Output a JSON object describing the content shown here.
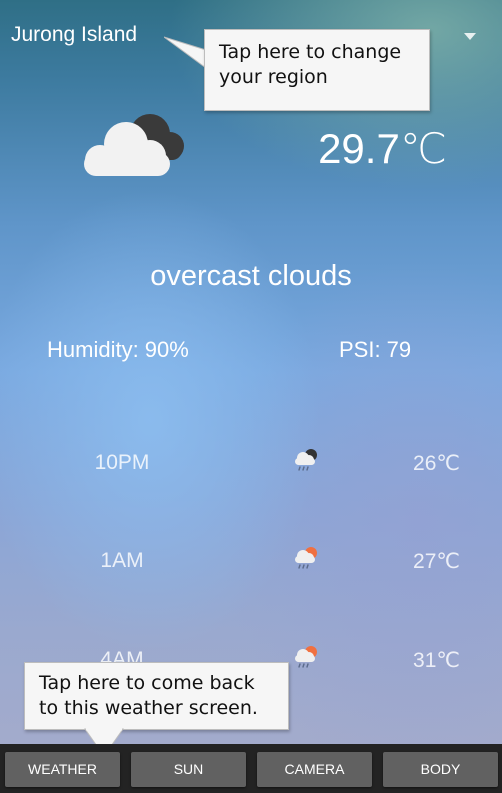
{
  "header": {
    "region": "Jurong Island",
    "dropdown_icon": "caret-down-icon"
  },
  "current": {
    "temperature": "29.7℃",
    "icon": "cloud-icon",
    "condition": "overcast clouds",
    "humidity": "Humidity: 90%",
    "psi": "PSI: 79"
  },
  "forecast": [
    {
      "time": "10PM",
      "icon": "night-rain-icon",
      "temp": "26℃"
    },
    {
      "time": "1AM",
      "icon": "rain-icon",
      "temp": "27℃"
    },
    {
      "time": "4AM",
      "icon": "rain-icon",
      "temp": "31℃"
    }
  ],
  "tooltips": {
    "region": "Tap here to change your region",
    "weather": "Tap here to come back to this weather screen."
  },
  "nav": {
    "weather": "WEATHER",
    "sun": "SUN",
    "camera": "CAMERA",
    "body": "BODY"
  },
  "colors": {
    "nav_bar": "#232323",
    "nav_button": "#616161",
    "tooltip_bg": "#f6f6f6"
  }
}
